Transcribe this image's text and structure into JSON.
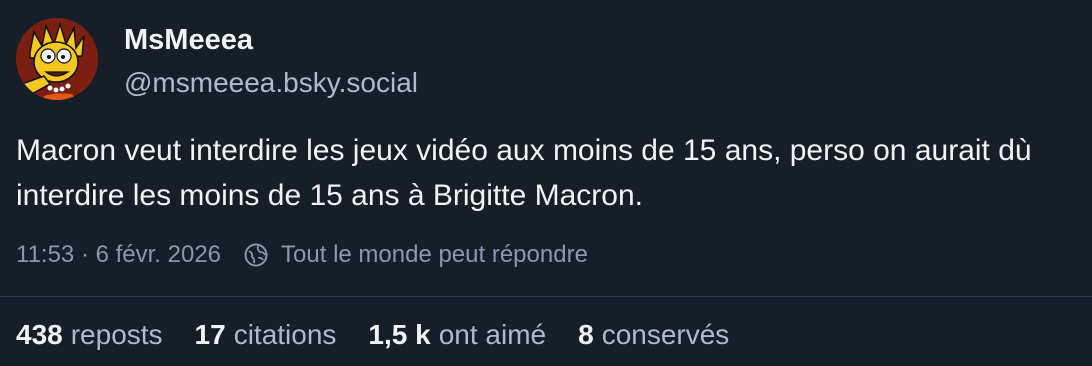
{
  "author": {
    "display_name": "MsMeeea",
    "handle": "@msmeeea.bsky.social",
    "avatar_icon": "lisa-simpson-avatar"
  },
  "post": {
    "text": "Macron veut interdire les jeux vidéo aux moins de 15 ans, perso on aurait dù interdire les moins de 15 ans à Brigitte Macron."
  },
  "meta": {
    "time_date": "11:53 · 6 févr. 2026",
    "reply_icon": "globe-icon",
    "reply_setting": "Tout le monde peut répondre"
  },
  "stats": [
    {
      "count": "438",
      "label": "reposts"
    },
    {
      "count": "17",
      "label": "citations"
    },
    {
      "count": "1,5 k",
      "label": "ont aimé"
    },
    {
      "count": "8",
      "label": "conservés"
    }
  ],
  "colors": {
    "background": "#161e27",
    "text": "#f1f3f5",
    "secondary": "#aebbc9",
    "muted": "#8a99a9",
    "divider": "#2b3a4a"
  }
}
